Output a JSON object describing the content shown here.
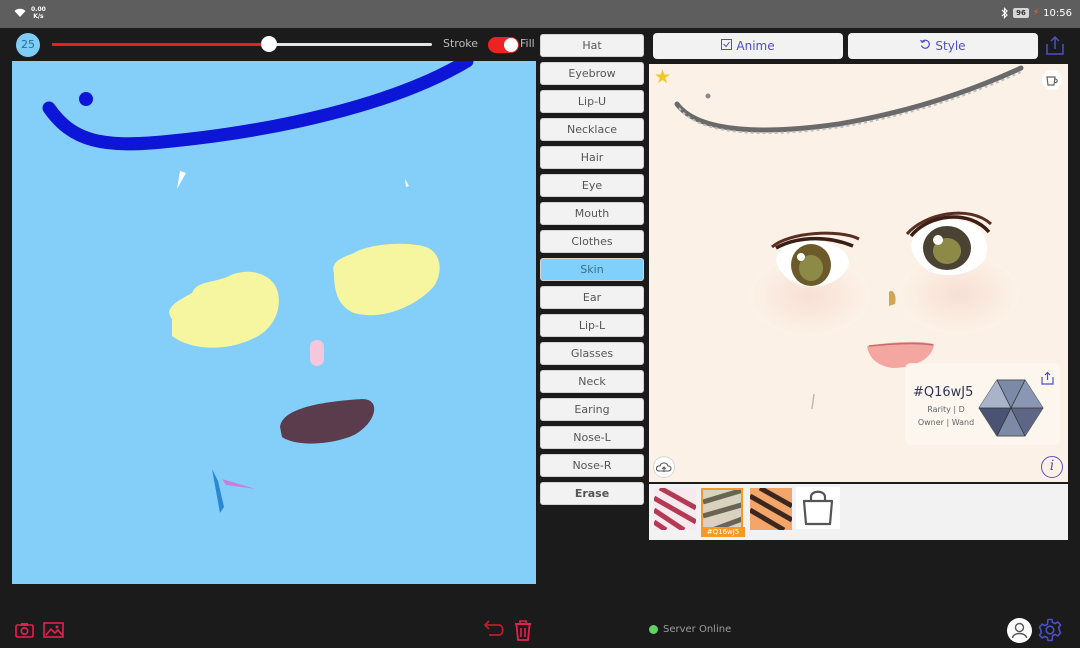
{
  "status_bar": {
    "net_speed": "0.00",
    "net_unit": "K/s",
    "battery": "96",
    "time": "10:56"
  },
  "toolbar": {
    "brush_size": "25",
    "size_level": 0.57,
    "stroke_label": "Stroke",
    "fill_label": "Fill",
    "fill_toggle_on": true,
    "accent": "#e81f1f"
  },
  "parts": [
    {
      "label": "Hat",
      "active": false
    },
    {
      "label": "Eyebrow",
      "active": false
    },
    {
      "label": "Lip-U",
      "active": false
    },
    {
      "label": "Necklace",
      "active": false
    },
    {
      "label": "Hair",
      "active": false
    },
    {
      "label": "Eye",
      "active": false
    },
    {
      "label": "Mouth",
      "active": false
    },
    {
      "label": "Clothes",
      "active": false
    },
    {
      "label": "Skin",
      "active": true
    },
    {
      "label": "Ear",
      "active": false
    },
    {
      "label": "Lip-L",
      "active": false
    },
    {
      "label": "Glasses",
      "active": false
    },
    {
      "label": "Neck",
      "active": false
    },
    {
      "label": "Earing",
      "active": false
    },
    {
      "label": "Nose-L",
      "active": false
    },
    {
      "label": "Nose-R",
      "active": false
    },
    {
      "label": "Erase",
      "active": false
    }
  ],
  "header": {
    "anime_label": "Anime",
    "style_label": "Style"
  },
  "card": {
    "id": "#Q16wJ5",
    "rarity": "Rarity | D",
    "owner": "Owner | Wand"
  },
  "thumbnails": {
    "selected_label": "#Q16wJ5"
  },
  "status": {
    "server": "Server Online",
    "online_color": "#5fd35f"
  },
  "colors": {
    "canvas_bg": "#84cff9",
    "skin_selected": "#7fd0fa",
    "brand": "#4c4fc8"
  }
}
